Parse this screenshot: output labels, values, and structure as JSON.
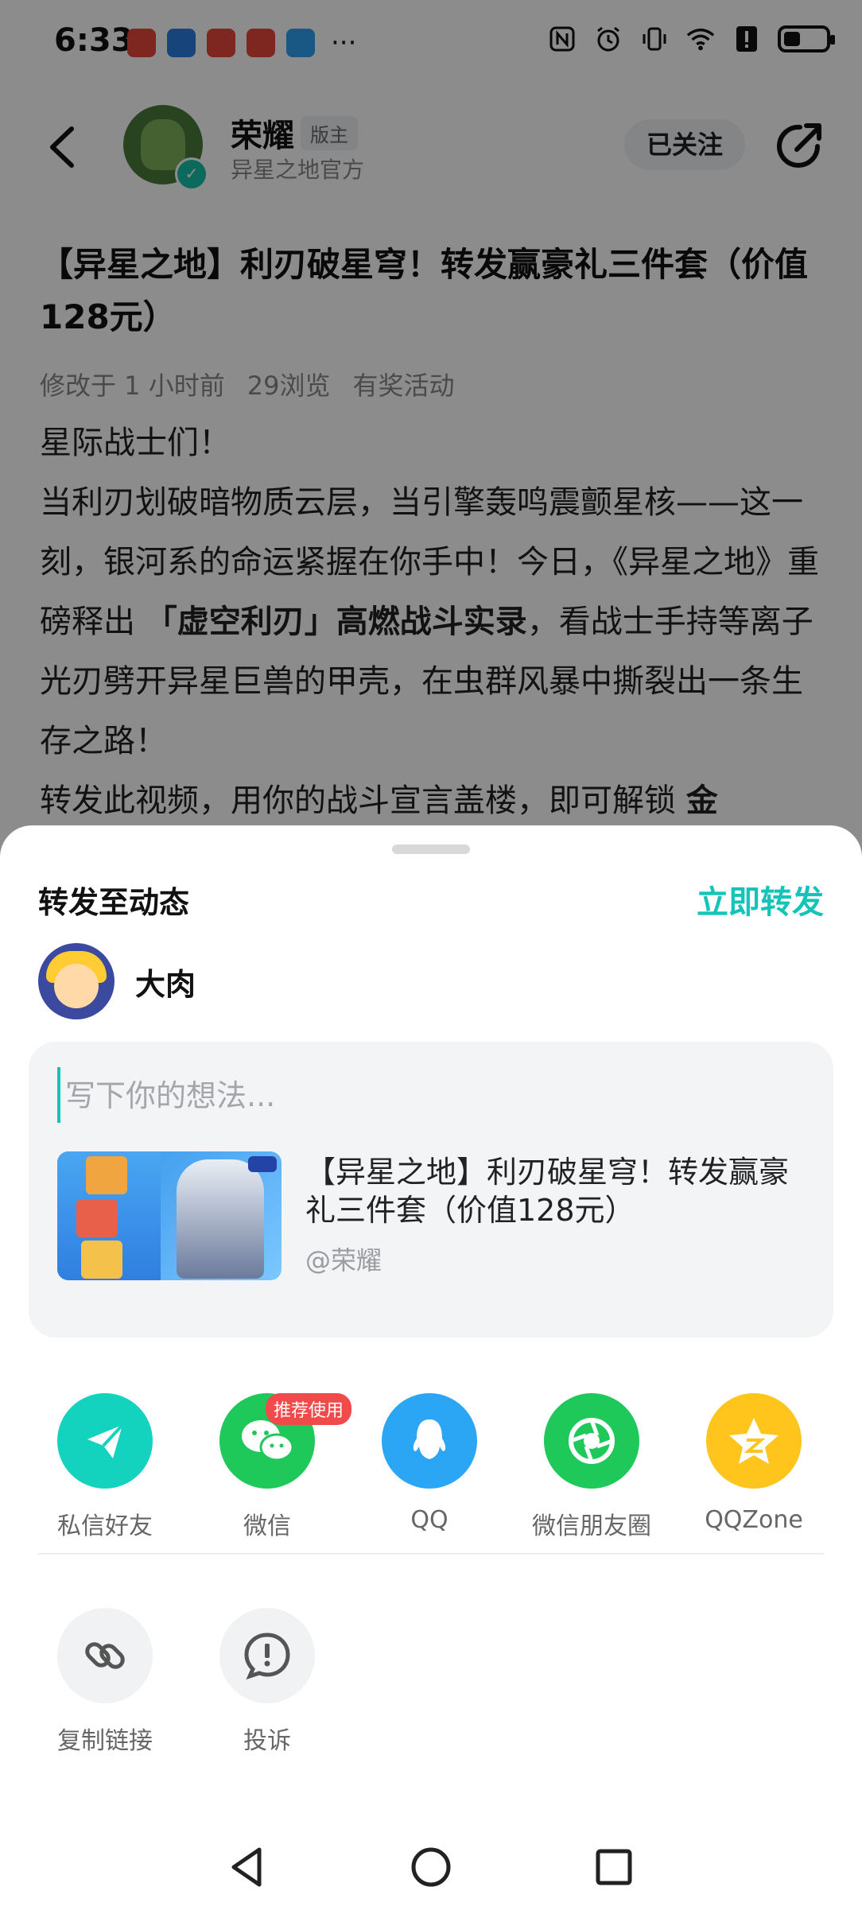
{
  "status_bar": {
    "time": "6:33",
    "more": "···",
    "battery_level": 0.4
  },
  "header": {
    "author_name": "荣耀",
    "author_tag": "版主",
    "author_subtitle": "异星之地官方",
    "follow_label": "已关注"
  },
  "article": {
    "title": "【异星之地】利刃破星穹！转发赢豪礼三件套（价值128元）",
    "meta": [
      "修改于 1 小时前",
      "29浏览",
      "有奖活动"
    ],
    "body": {
      "greeting": "星际战士们！",
      "line1": "当利刃划破暗物质云层，当引擎轰鸣震颤星核——这一刻，银河系的命运紧握在你手中！今日，《异星之地》重磅释出 ",
      "bold1": "「虚空利刃」高燃战斗实录",
      "line2": "，看战士手持等离子光刃劈开异星巨兽的甲壳，在虫群风暴中撕裂出一条生存之路！",
      "line3": "转发此视频，用你的战斗宣言盖楼，即可解锁 ",
      "bold2": "金"
    }
  },
  "share_sheet": {
    "title": "转发至动态",
    "action": "立即转发",
    "user_name": "大肉",
    "compose_placeholder": "写下你的想法...",
    "preview_title": "【异星之地】利刃破星穹！转发赢豪礼三件套（价值128元）",
    "preview_author": "@荣耀",
    "accent_color": "#14c4b8",
    "targets": [
      {
        "label": "私信好友",
        "icon": "paper-plane-icon",
        "color": "#14d3be"
      },
      {
        "label": "微信",
        "icon": "wechat-icon",
        "color": "#1ec95a",
        "badge": "推荐使用"
      },
      {
        "label": "QQ",
        "icon": "qq-penguin-icon",
        "color": "#2aa6f5"
      },
      {
        "label": "微信朋友圈",
        "icon": "moments-shutter-icon",
        "color": "#1ec95a"
      },
      {
        "label": "QQZone",
        "icon": "qzone-star-icon",
        "color": "#ffc51c"
      }
    ],
    "tools": [
      {
        "label": "复制链接",
        "icon": "link-icon"
      },
      {
        "label": "投诉",
        "icon": "report-icon"
      }
    ]
  },
  "nav": {
    "back": "back-triangle-icon",
    "home": "home-circle-icon",
    "recents": "recents-square-icon"
  }
}
